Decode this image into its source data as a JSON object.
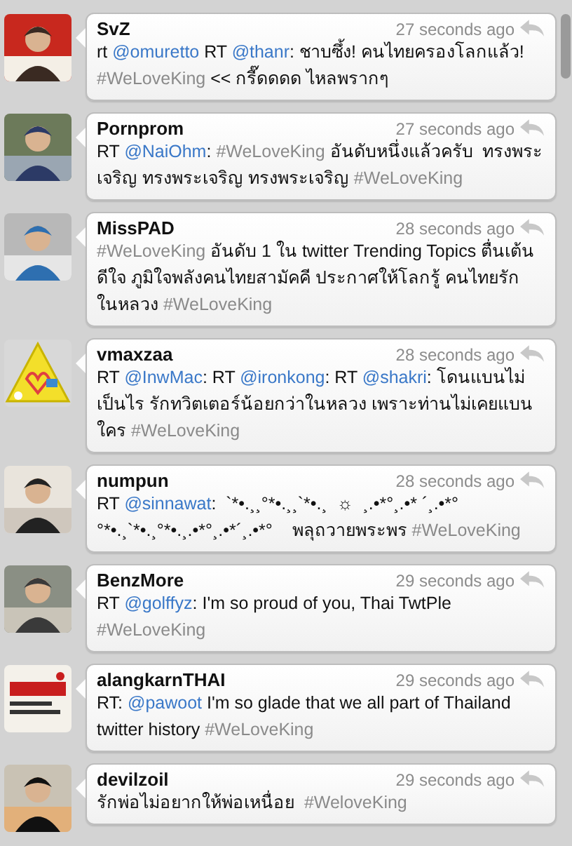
{
  "tweets": [
    {
      "user": "SvZ",
      "time": "27 seconds ago",
      "body": [
        {
          "kind": "text",
          "text": "rt "
        },
        {
          "kind": "mention",
          "text": "@omuretto"
        },
        {
          "kind": "text",
          "text": " RT "
        },
        {
          "kind": "mention",
          "text": "@thanr"
        },
        {
          "kind": "text",
          "text": ": ชาบซึ้ง! คนไทยครองโลกแล้ว! "
        },
        {
          "kind": "hashtag",
          "text": "#WeLoveKing"
        },
        {
          "kind": "text",
          "text": " << กรี๊ดดดด ไหลพรากๆ"
        }
      ]
    },
    {
      "user": "Pornprom",
      "time": "27 seconds ago",
      "body": [
        {
          "kind": "text",
          "text": "RT "
        },
        {
          "kind": "mention",
          "text": "@NaiOhm"
        },
        {
          "kind": "text",
          "text": ": "
        },
        {
          "kind": "hashtag",
          "text": "#WeLoveKing"
        },
        {
          "kind": "text",
          "text": " อันดับหนึ่งแล้วครับ  ทรงพระเจริญ ทรงพระเจริญ ทรงพระเจริญ "
        },
        {
          "kind": "hashtag",
          "text": "#WeLoveKing"
        }
      ]
    },
    {
      "user": "MissPAD",
      "time": "28 seconds ago",
      "body": [
        {
          "kind": "hashtag",
          "text": "#WeLoveKing"
        },
        {
          "kind": "text",
          "text": " อันดับ 1 ใน twitter Trending Topics ตื่นเต้น ดีใจ ภูมิใจพลังคนไทยสามัคคี ประกาศให้โลกรู้ คนไทยรักในหลวง "
        },
        {
          "kind": "hashtag",
          "text": "#WeLoveKing"
        }
      ]
    },
    {
      "user": "vmaxzaa",
      "time": "28 seconds ago",
      "body": [
        {
          "kind": "text",
          "text": "RT "
        },
        {
          "kind": "mention",
          "text": "@InwMac"
        },
        {
          "kind": "text",
          "text": ": RT "
        },
        {
          "kind": "mention",
          "text": "@ironkong"
        },
        {
          "kind": "text",
          "text": ": RT "
        },
        {
          "kind": "mention",
          "text": "@shakri"
        },
        {
          "kind": "text",
          "text": ": โดนแบนไม่เป็นไร รักทวิตเตอร์น้อยกว่าในหลวง เพราะท่านไม่เคยแบนใคร "
        },
        {
          "kind": "hashtag",
          "text": "#WeLoveKing"
        }
      ]
    },
    {
      "user": "numpun",
      "time": "28 seconds ago",
      "body": [
        {
          "kind": "text",
          "text": "RT "
        },
        {
          "kind": "mention",
          "text": "@sinnawat"
        },
        {
          "kind": "text",
          "text": ":  `*•.¸¸°*•.¸¸`*•.¸  ☼  ¸.•*°¸.•* ´¸.•*°      °*•.¸`*•.¸°*•.¸.•*°¸.•*´¸.•*°    พลุถวายพระพร "
        },
        {
          "kind": "hashtag",
          "text": "#WeLoveKing"
        }
      ]
    },
    {
      "user": "BenzMore",
      "time": "29 seconds ago",
      "body": [
        {
          "kind": "text",
          "text": "RT "
        },
        {
          "kind": "mention",
          "text": "@golffyz"
        },
        {
          "kind": "text",
          "text": ": I'm so proud of you, Thai TwtPle "
        },
        {
          "kind": "hashtag",
          "text": "#WeLoveKing"
        }
      ]
    },
    {
      "user": "alangkarnTHAI",
      "time": "29 seconds ago",
      "body": [
        {
          "kind": "text",
          "text": "RT: "
        },
        {
          "kind": "mention",
          "text": "@pawoot"
        },
        {
          "kind": "text",
          "text": " I'm so glade that we all part of Thailand twitter history "
        },
        {
          "kind": "hashtag",
          "text": "#WeLoveKing"
        }
      ]
    },
    {
      "user": "devilzoil",
      "time": "29 seconds ago",
      "body": [
        {
          "kind": "text",
          "text": "รักพ่อไม่อยากให้พ่อเหนื่อย  "
        },
        {
          "kind": "hashtag",
          "text": "#WeloveKing"
        }
      ]
    }
  ]
}
